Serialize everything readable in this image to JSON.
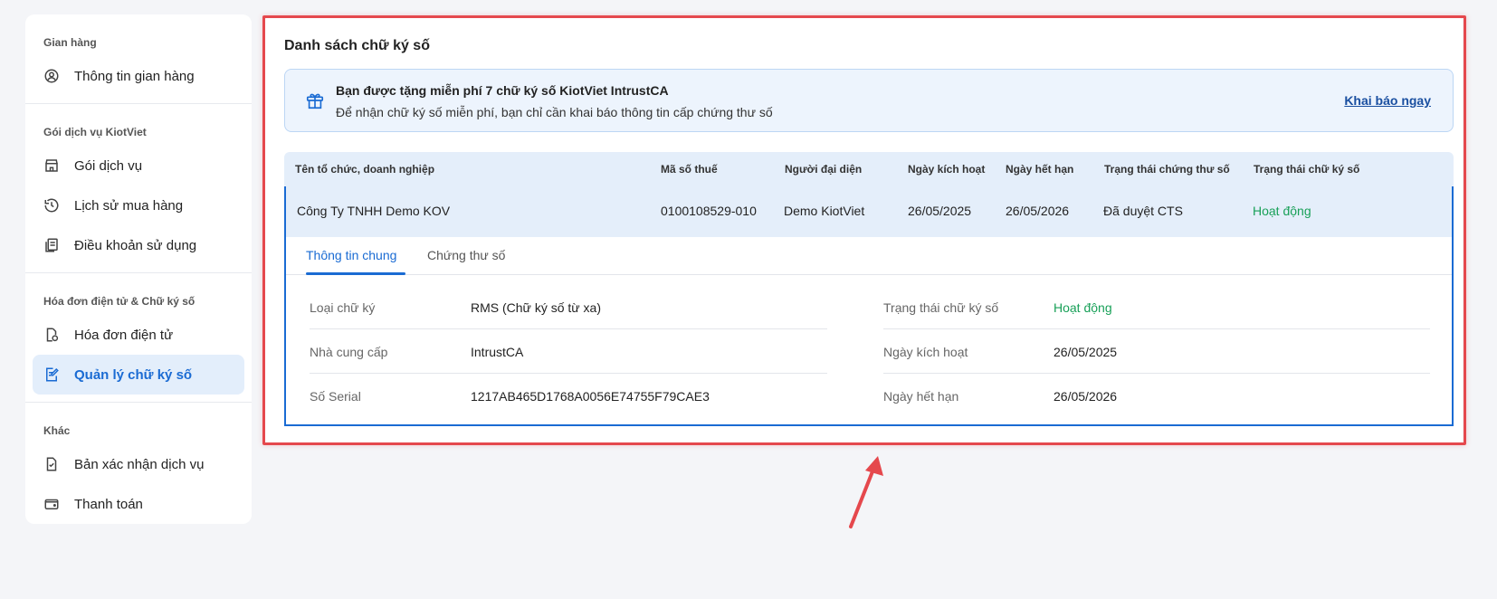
{
  "sidebar": {
    "groups": [
      {
        "heading": "Gian hàng",
        "items": [
          {
            "label": "Thông tin gian hàng",
            "icon": "user-circle-icon"
          }
        ]
      },
      {
        "heading": "Gói dịch vụ KiotViet",
        "items": [
          {
            "label": "Gói dịch vụ",
            "icon": "store-icon"
          },
          {
            "label": "Lịch sử mua hàng",
            "icon": "history-icon"
          },
          {
            "label": "Điều khoản sử dụng",
            "icon": "document-stack-icon"
          }
        ]
      },
      {
        "heading": "Hóa đơn điện tử & Chữ ký số",
        "items": [
          {
            "label": "Hóa đơn điện tử",
            "icon": "invoice-icon"
          },
          {
            "label": "Quản lý chữ ký số",
            "icon": "signature-icon"
          }
        ]
      },
      {
        "heading": "Khác",
        "items": [
          {
            "label": "Bản xác nhận dịch vụ",
            "icon": "file-check-icon"
          },
          {
            "label": "Thanh toán",
            "icon": "wallet-icon"
          }
        ]
      }
    ]
  },
  "main": {
    "title": "Danh sách chữ ký số",
    "banner": {
      "title": "Bạn được tặng miễn phí 7 chữ ký số KiotViet IntrustCA",
      "subtitle": "Để nhận chữ ký số miễn phí, bạn chỉ cần khai báo thông tin cấp chứng thư số",
      "link": "Khai báo ngay",
      "icon": "gift-icon"
    },
    "table": {
      "headers": [
        "Tên tổ chức, doanh nghiệp",
        "Mã số thuế",
        "Người đại diện",
        "Ngày kích hoạt",
        "Ngày hết hạn",
        "Trạng thái chứng thư số",
        "Trạng thái chữ ký số"
      ],
      "row": [
        "Công Ty TNHH Demo KOV",
        "0100108529-010",
        "Demo KiotViet",
        "26/05/2025",
        "26/05/2026",
        "Đã duyệt CTS",
        "Hoạt động"
      ]
    },
    "tabs": [
      "Thông tin chung",
      "Chứng thư số"
    ],
    "details": {
      "left": [
        {
          "label": "Loại chữ ký",
          "value": "RMS (Chữ ký số từ xa)"
        },
        {
          "label": "Nhà cung cấp",
          "value": "IntrustCA"
        },
        {
          "label": "Số Serial",
          "value": "1217AB465D1768A0056E74755F79CAE3"
        }
      ],
      "right": [
        {
          "label": "Trạng thái chữ ký số",
          "value": "Hoạt động"
        },
        {
          "label": "Ngày kích hoạt",
          "value": "26/05/2025"
        },
        {
          "label": "Ngày hết hạn",
          "value": "26/05/2026"
        }
      ]
    }
  },
  "colors": {
    "accent": "#1a6bd3",
    "success": "#18a058",
    "highlight": "#e5484d"
  }
}
